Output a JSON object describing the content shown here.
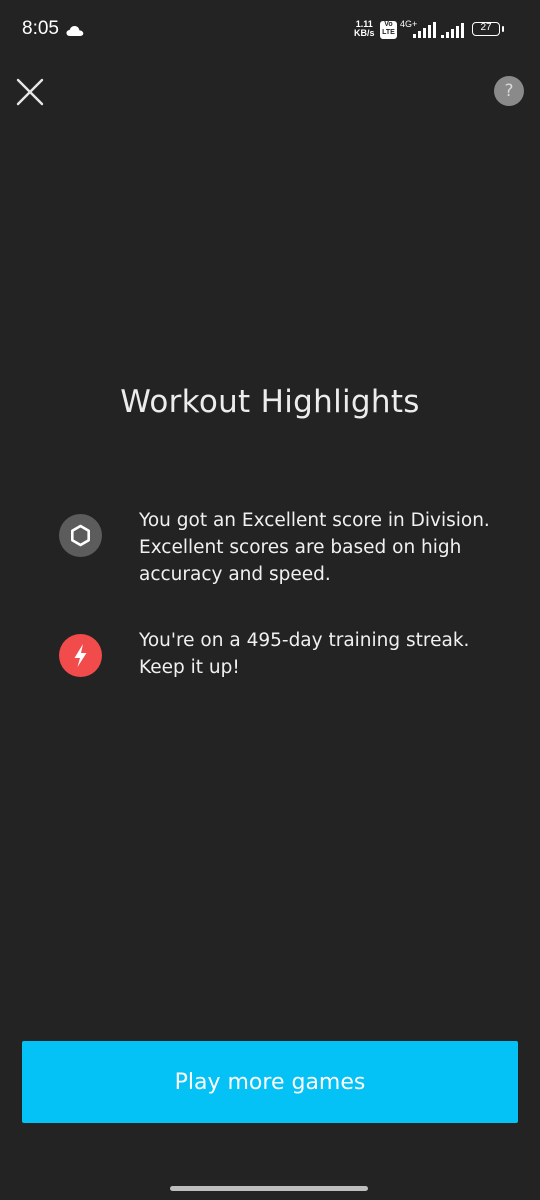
{
  "status_bar": {
    "time": "8:05",
    "net_speed_value": "1.11",
    "net_speed_unit": "KB/s",
    "volte_top": "Vo",
    "volte_bottom": "LTE",
    "network_type": "4G+",
    "battery_level": "27"
  },
  "header": {
    "help_label": "?"
  },
  "main": {
    "title": "Workout Highlights",
    "highlights": [
      {
        "icon": "hexagon-icon",
        "text": "You got an Excellent score in Division. Excellent scores are based on high accuracy and speed."
      },
      {
        "icon": "lightning-icon",
        "text": "You're on a 495-day training streak. Keep it up!"
      }
    ]
  },
  "footer": {
    "play_button_label": "Play more games"
  },
  "colors": {
    "background": "#232323",
    "accent": "#04c1f6",
    "streak_red": "#f24b4b",
    "badge_gray": "#5c5c5c"
  }
}
